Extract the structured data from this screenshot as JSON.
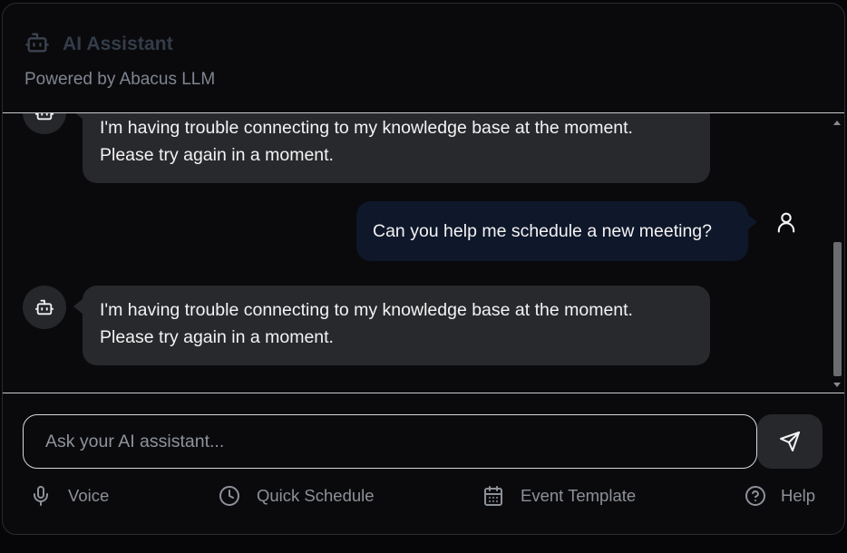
{
  "header": {
    "title": "AI Assistant",
    "subtitle": "Powered by Abacus LLM",
    "icon": "bot-icon"
  },
  "messages": [
    {
      "role": "assistant",
      "lines": [
        "I'm having trouble connecting to my knowledge base at the moment.",
        "Please try again in a moment."
      ]
    },
    {
      "role": "user",
      "text": "Can you help me schedule a new meeting?"
    },
    {
      "role": "assistant",
      "lines": [
        "I'm having trouble connecting to my knowledge base at the moment.",
        "Please try again in a moment."
      ]
    }
  ],
  "input": {
    "placeholder": "Ask your AI assistant...",
    "value": ""
  },
  "send": {
    "icon": "send-icon"
  },
  "actions": {
    "voice": {
      "label": "Voice",
      "icon": "microphone-icon"
    },
    "quick_schedule": {
      "label": "Quick Schedule",
      "icon": "clock-icon"
    },
    "event_template": {
      "label": "Event Template",
      "icon": "calendar-icon"
    },
    "help": {
      "label": "Help",
      "icon": "help-circle-icon"
    }
  },
  "colors": {
    "background": "#0a0a0c",
    "bot_bubble": "#28292d",
    "user_bubble": "#0f172a",
    "text": "#f3f3f3",
    "muted": "#8d9199"
  }
}
